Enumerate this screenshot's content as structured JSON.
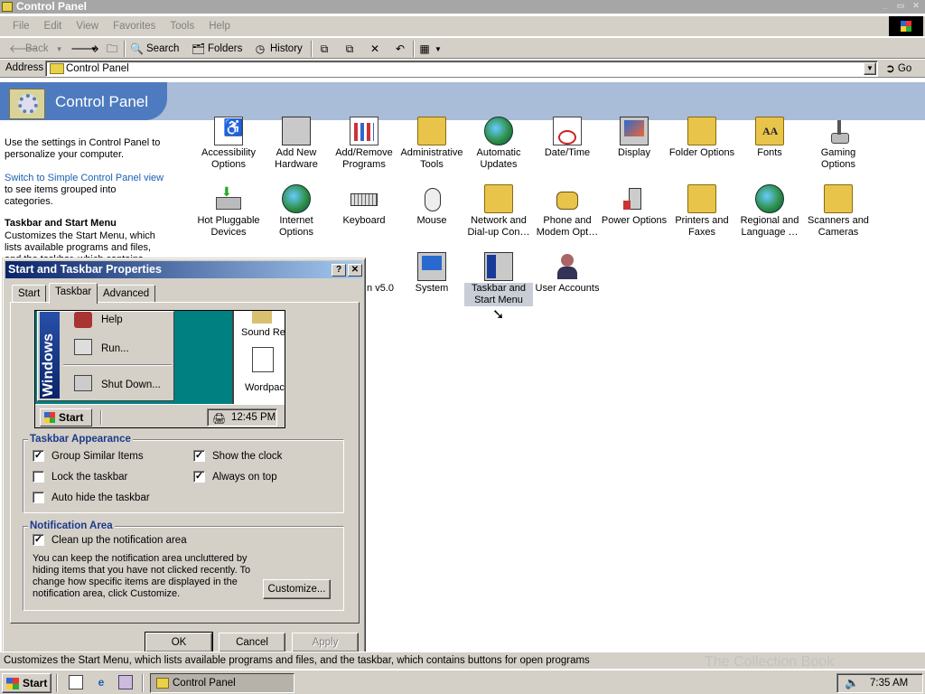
{
  "window": {
    "title": "Control Panel"
  },
  "menubar": {
    "items": [
      "File",
      "Edit",
      "View",
      "Favorites",
      "Tools",
      "Help"
    ]
  },
  "toolbar": {
    "back": "Back",
    "search": "Search",
    "folders": "Folders",
    "history": "History"
  },
  "address": {
    "label": "Address",
    "value": "Control Panel",
    "go": "Go"
  },
  "header": {
    "title": "Control Panel"
  },
  "left_pane": {
    "description": "Use the settings in Control Panel to personalize your computer.",
    "link": "Switch to Simple Control Panel view",
    "link_suffix": "to see items grouped into categories.",
    "selected_title": "Taskbar and Start Menu",
    "selected_description": "Customizes the Start Menu, which lists available programs and files, and the taskbar, which contains buttons for open programs"
  },
  "icons": [
    {
      "label": "Accessibility Options",
      "icon": "accessibility-icon"
    },
    {
      "label": "Add New Hardware",
      "icon": "hardware-icon"
    },
    {
      "label": "Add/Remove Programs",
      "icon": "programs-icon"
    },
    {
      "label": "Administrative Tools",
      "icon": "admin-tools-icon"
    },
    {
      "label": "Automatic Updates",
      "icon": "updates-icon"
    },
    {
      "label": "Date/Time",
      "icon": "calendar-icon"
    },
    {
      "label": "Display",
      "icon": "display-icon"
    },
    {
      "label": "Folder Options",
      "icon": "folder-options-icon"
    },
    {
      "label": "Fonts",
      "icon": "fonts-icon"
    },
    {
      "label": "Gaming Options",
      "icon": "joystick-icon"
    },
    {
      "label": "Hot Pluggable Devices",
      "icon": "hotplug-icon"
    },
    {
      "label": "Internet Options",
      "icon": "internet-icon"
    },
    {
      "label": "Keyboard",
      "icon": "keyboard-icon"
    },
    {
      "label": "Mouse",
      "icon": "mouse-icon"
    },
    {
      "label": "Network and Dial-up Con…",
      "icon": "network-icon"
    },
    {
      "label": "Phone and Modem Opt…",
      "icon": "phone-icon"
    },
    {
      "label": "Power Options",
      "icon": "power-icon"
    },
    {
      "label": "Printers and Faxes",
      "icon": "printer-icon"
    },
    {
      "label": "Regional and Language …",
      "icon": "globe-icon"
    },
    {
      "label": "Scanners and Cameras",
      "icon": "scanner-icon"
    },
    {
      "label": "n v5.0",
      "icon": "partial-icon"
    },
    {
      "label": "System",
      "icon": "system-icon"
    },
    {
      "label": "Taskbar and Start Menu",
      "icon": "taskbar-icon"
    },
    {
      "label": "User Accounts",
      "icon": "users-icon"
    }
  ],
  "dialog": {
    "title": "Start and Taskbar Properties",
    "tabs": [
      "Start",
      "Taskbar",
      "Advanced"
    ],
    "active_tab": "Taskbar",
    "preview": {
      "brand": "Windows",
      "menu_items": [
        "Help",
        "Run...",
        "Shut Down..."
      ],
      "desktop_items": [
        "Sound Re",
        "Wordpac"
      ],
      "start": "Start",
      "clock": "12:45 PM"
    },
    "appearance": {
      "title": "Taskbar Appearance",
      "options": [
        {
          "label": "Group Similar Items",
          "checked": true
        },
        {
          "label": "Show the clock",
          "checked": true
        },
        {
          "label": "Lock the taskbar",
          "checked": false
        },
        {
          "label": "Always on top",
          "checked": true
        },
        {
          "label": "Auto hide the taskbar",
          "checked": false
        }
      ]
    },
    "notification": {
      "title": "Notification Area",
      "option": {
        "label": "Clean up the notification area",
        "checked": true
      },
      "text": "You can keep the notification area uncluttered by hiding items that you have not clicked recently.  To change how specific items are displayed in the notification area, click Customize.",
      "customize": "Customize..."
    },
    "buttons": {
      "ok": "OK",
      "cancel": "Cancel",
      "apply": "Apply"
    }
  },
  "status": {
    "text": "Customizes the Start Menu, which lists available programs and files, and the taskbar, which contains buttons for open programs"
  },
  "taskbar": {
    "start": "Start",
    "task": "Control Panel",
    "clock": "7:35 AM"
  },
  "watermark": "The Collection Book"
}
